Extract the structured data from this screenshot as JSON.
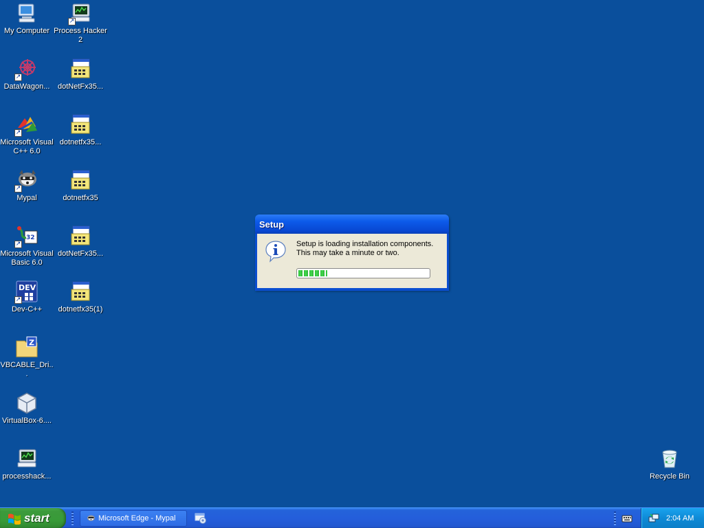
{
  "desktop": {
    "icons": [
      {
        "label": "My Computer"
      },
      {
        "label": "Process Hacker\n2"
      },
      {
        "label": "DataWagon..."
      },
      {
        "label": "dotNetFx35..."
      },
      {
        "label": "Microsoft Visual\nC++ 6.0"
      },
      {
        "label": "dotnetfx35..."
      },
      {
        "label": "Mypal"
      },
      {
        "label": "dotnetfx35"
      },
      {
        "label": "Microsoft Visual\nBasic 6.0"
      },
      {
        "label": "dotNetFx35..."
      },
      {
        "label": "Dev-C++"
      },
      {
        "label": "dotnetfx35(1)"
      },
      {
        "label": "VBCABLE_Dri..."
      },
      {
        "label": "VirtualBox-6...."
      },
      {
        "label": "processhack..."
      },
      {
        "label": "Recycle Bin"
      }
    ]
  },
  "dialog": {
    "title": "Setup",
    "message_line1": "Setup is loading installation components.",
    "message_line2": "This may take a minute or two.",
    "progress": 0.22
  },
  "taskbar": {
    "start_label": "start",
    "tasks": [
      {
        "label": "Microsoft Edge - Mypal",
        "icon": "mypal-raccoon-icon"
      }
    ],
    "clock": "2:04 AM"
  },
  "colors": {
    "desktop_bg": "#0a4f9c",
    "taskbar_blue": "#245edb",
    "start_green": "#389b38",
    "tray_blue": "#0e8ad6",
    "progress_green": "#2ec23a"
  }
}
